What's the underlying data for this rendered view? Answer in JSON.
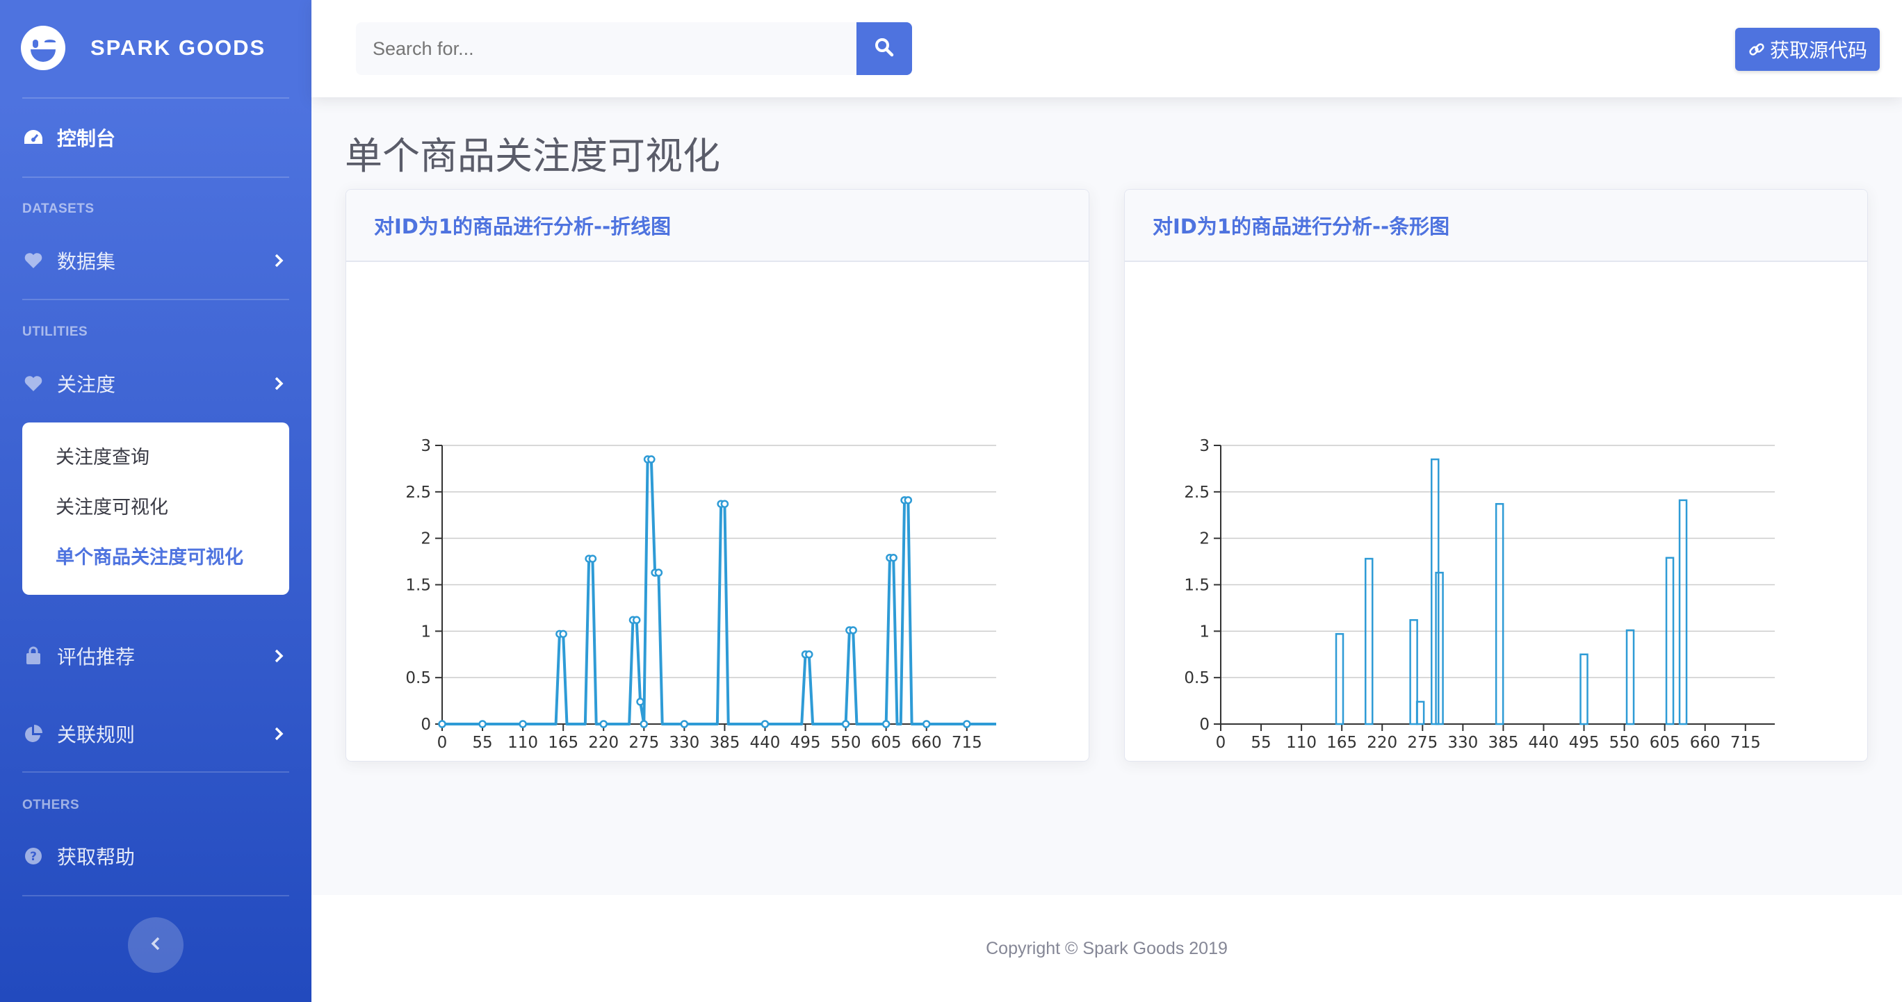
{
  "brand": {
    "name": "SPARK GOODS"
  },
  "sidebar": {
    "dashboard": "控制台",
    "headings": {
      "datasets": "DATASETS",
      "utilities": "UTILITIES",
      "others": "OTHERS"
    },
    "items": {
      "datasets": "数据集",
      "attention": "关注度",
      "evaluate": "评估推荐",
      "rules": "关联规则",
      "help": "获取帮助"
    },
    "submenu": [
      "关注度查询",
      "关注度可视化",
      "单个商品关注度可视化"
    ],
    "active_sub": "单个商品关注度可视化"
  },
  "topbar": {
    "search_placeholder": "Search for...",
    "source_button": "获取源代码"
  },
  "page": {
    "title": "单个商品关注度可视化"
  },
  "cards": {
    "line_title": "对ID为1的商品进行分析--折线图",
    "bar_title": "对ID为1的商品进行分析--条形图"
  },
  "footer": {
    "copyright": "Copyright © Spark Goods 2019"
  },
  "colors": {
    "accent": "#4e73df",
    "series": "#2e9bd6"
  },
  "chart_data": [
    {
      "type": "line",
      "title": "对ID为1的商品进行分析--折线图",
      "xlim": [
        0,
        755
      ],
      "xticks": [
        0,
        55,
        110,
        165,
        220,
        275,
        330,
        385,
        440,
        495,
        550,
        605,
        660,
        715
      ],
      "ylim": [
        0,
        3
      ],
      "yticks": [
        0,
        0.5,
        1,
        1.5,
        2,
        2.5,
        3
      ],
      "grid": true,
      "series": [
        {
          "x": [
            0,
            55,
            110,
            155,
            160,
            165,
            170,
            175,
            195,
            200,
            205,
            210,
            215,
            220,
            255,
            260,
            265,
            270,
            275,
            280,
            285,
            290,
            295,
            300,
            305,
            310,
            330,
            375,
            380,
            385,
            390,
            440,
            490,
            495,
            500,
            505,
            550,
            555,
            560,
            565,
            605,
            610,
            615,
            620,
            625,
            630,
            635,
            640,
            660,
            715,
            755
          ],
          "y": [
            0,
            0,
            0,
            0,
            0.97,
            0.97,
            0,
            0,
            0,
            1.78,
            1.78,
            0,
            0,
            0,
            0,
            1.12,
            1.12,
            0.24,
            0,
            2.85,
            2.85,
            1.63,
            1.63,
            0,
            0,
            0,
            0,
            0,
            2.37,
            2.37,
            0,
            0,
            0,
            0.75,
            0.75,
            0,
            0,
            1.01,
            1.01,
            0,
            0,
            1.79,
            1.79,
            0,
            0,
            2.41,
            2.41,
            0,
            0,
            0,
            0
          ]
        }
      ]
    },
    {
      "type": "bar",
      "title": "对ID为1的商品进行分析--条形图",
      "xlim": [
        0,
        755
      ],
      "xticks": [
        0,
        55,
        110,
        165,
        220,
        275,
        330,
        385,
        440,
        495,
        550,
        605,
        660,
        715
      ],
      "ylim": [
        0,
        3
      ],
      "yticks": [
        0,
        0.5,
        1,
        1.5,
        2,
        2.5,
        3
      ],
      "grid": true,
      "series": [
        {
          "x": [
            162,
            202,
            263,
            272,
            292,
            298,
            380,
            495,
            558,
            612,
            630
          ],
          "y": [
            0.97,
            1.78,
            1.12,
            0.24,
            2.85,
            1.63,
            2.37,
            0.75,
            1.01,
            1.79,
            2.41
          ]
        }
      ]
    }
  ]
}
